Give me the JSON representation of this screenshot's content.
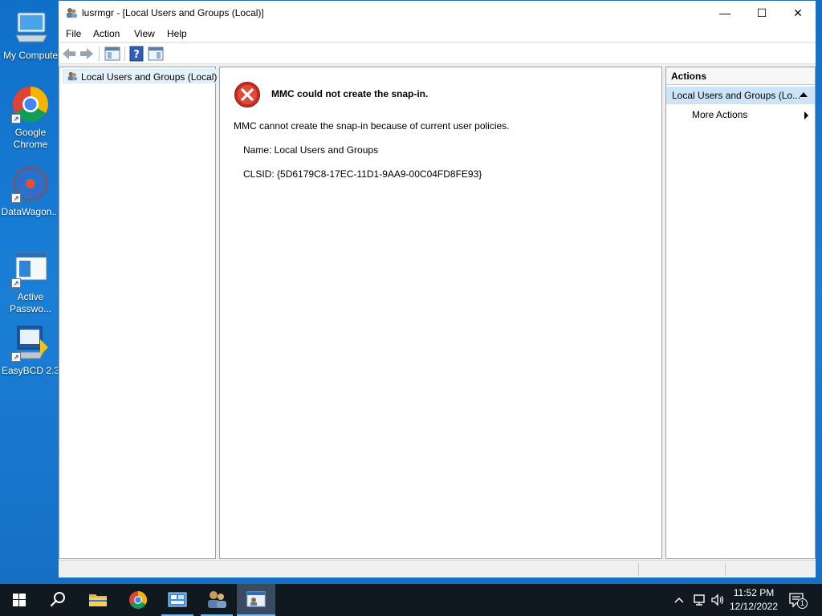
{
  "desktop": {
    "icons": [
      {
        "label": "My Compute"
      },
      {
        "label": "Google Chrome"
      },
      {
        "label": "DataWagon..."
      },
      {
        "label": "Active Passwo..."
      },
      {
        "label": "EasyBCD 2.3"
      }
    ]
  },
  "window": {
    "title": "lusrmgr - [Local Users and Groups (Local)]",
    "controls": {
      "minimize": "—",
      "maximize": "☐",
      "close": "✕"
    },
    "menu": [
      "File",
      "Action",
      "View",
      "Help"
    ],
    "tree": {
      "root": "Local Users and Groups (Local)"
    },
    "error": {
      "title": "MMC could not create the snap-in.",
      "message": "MMC cannot create the snap-in because of current user policies.",
      "name_line": "Name: Local Users and Groups",
      "clsid_line": "CLSID: {5D6179C8-17EC-11D1-9AA9-00C04FD8FE93}"
    },
    "actions": {
      "header": "Actions",
      "selected": "Local Users and Groups (Lo...",
      "more": "More Actions"
    }
  },
  "taskbar": {
    "time": "11:52 PM",
    "date": "12/12/2022",
    "notification_count": "1"
  },
  "colors": {
    "desktop": "#1570c4",
    "taskbar": "#101820",
    "selection": "#cce4f7",
    "error_red": "#c42b1c"
  }
}
